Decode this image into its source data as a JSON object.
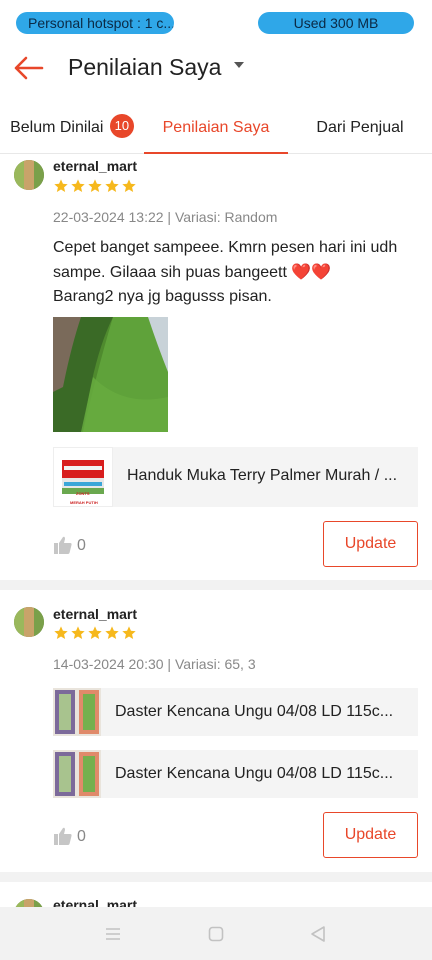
{
  "status_bar": {
    "hotspot_text": "Personal hotspot : 1 c...",
    "data_used_text": "Used  300 MB",
    "pill_color": "#2fa7e8"
  },
  "header": {
    "title": "Penilaian Saya"
  },
  "tabs": [
    {
      "label": "Belum Dinilai",
      "badge": "10"
    },
    {
      "label": "Penilaian Saya",
      "active": true
    },
    {
      "label": "Dari Penjual"
    }
  ],
  "reviews": [
    {
      "username": "eternal_mart",
      "rating": 5,
      "meta": "22-03-2024 13:22 | Variasi: Random",
      "text_lines": [
        "Cepet banget sampeee. Kmrn pesen hari ini udh",
        "sampe. Gilaaa sih puas bangeett ❤️❤️",
        "Barang2 nya jg bagusss pisan."
      ],
      "products": [
        {
          "name": "Handuk Muka Terry Palmer Murah / ...",
          "thumb_caption_top": "ZONTS",
          "thumb_caption_bottom": "MERAH PUTIH"
        }
      ],
      "likes": "0",
      "button_label": "Update"
    },
    {
      "username": "eternal_mart",
      "rating": 5,
      "meta": "14-03-2024 20:30 | Variasi: 65, 3",
      "products": [
        {
          "name": "Daster Kencana Ungu 04/08 LD 115c..."
        },
        {
          "name": "Daster Kencana Ungu 04/08 LD 115c..."
        }
      ],
      "likes": "0",
      "button_label": "Update"
    },
    {
      "username": "eternal_mart"
    }
  ],
  "colors": {
    "accent": "#e8472a",
    "star": "#f6b81c"
  },
  "icons": {
    "back": "arrow-left-icon",
    "dropdown": "caret-down-icon",
    "star": "star-icon",
    "like": "thumbs-up-icon",
    "nav_menu": "menu-icon",
    "nav_home": "square-icon",
    "nav_back": "triangle-back-icon"
  }
}
